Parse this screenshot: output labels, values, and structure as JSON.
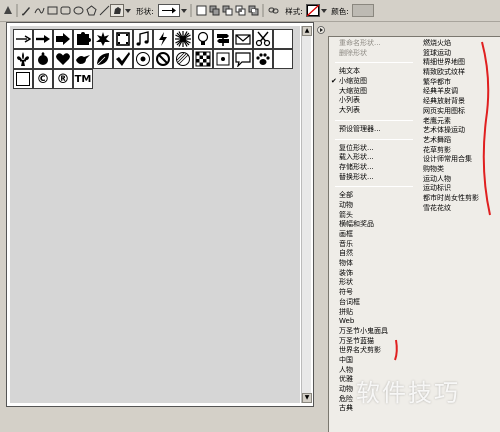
{
  "toolbar": {
    "shape_label": "形状:",
    "style_label": "样式:",
    "color_label": "颜色:"
  },
  "shapes": [
    {
      "icon": "arrow-right-thin-icon"
    },
    {
      "icon": "arrow-right-medium-icon"
    },
    {
      "icon": "arrow-right-bold-icon"
    },
    {
      "icon": "puzzle-piece-icon"
    },
    {
      "icon": "burst-star-icon"
    },
    {
      "icon": "film-frame-icon"
    },
    {
      "icon": "music-note-icon"
    },
    {
      "icon": "lightning-icon"
    },
    {
      "icon": "sun-burst-icon"
    },
    {
      "icon": "light-bulb-icon"
    },
    {
      "icon": "sign-post-icon"
    },
    {
      "icon": "envelope-icon"
    },
    {
      "icon": "scissors-icon"
    },
    {
      "icon": "blank-tile-icon"
    },
    {
      "icon": "fleur-de-lis-icon"
    },
    {
      "icon": "ornament-icon"
    },
    {
      "icon": "heart-icon"
    },
    {
      "icon": "bird-icon"
    },
    {
      "icon": "leaf-icon"
    },
    {
      "icon": "checkmark-icon"
    },
    {
      "icon": "target-icon"
    },
    {
      "icon": "no-sign-icon"
    },
    {
      "icon": "hatched-circle-icon"
    },
    {
      "icon": "checkerboard-icon"
    },
    {
      "icon": "square-dot-icon"
    },
    {
      "icon": "speech-bubble-icon"
    },
    {
      "icon": "paw-print-icon"
    },
    {
      "icon": "blank-tile-icon"
    },
    {
      "icon": "square-frame-icon"
    },
    {
      "icon": "copyright-icon",
      "text": "©"
    },
    {
      "icon": "registered-icon",
      "text": "®"
    },
    {
      "icon": "trademark-icon",
      "text": "TM"
    }
  ],
  "menu": {
    "col1": [
      {
        "label": "重命名形状...",
        "disabled": true
      },
      {
        "label": "删除形状",
        "disabled": true
      },
      {
        "sep": true
      },
      {
        "label": "纯文本"
      },
      {
        "label": "小缩览图",
        "checked": true
      },
      {
        "label": "大缩览图"
      },
      {
        "label": "小列表"
      },
      {
        "label": "大列表"
      },
      {
        "sep": true
      },
      {
        "label": "预设管理器..."
      },
      {
        "sep": true
      },
      {
        "label": "复位形状..."
      },
      {
        "label": "载入形状..."
      },
      {
        "label": "存储形状..."
      },
      {
        "label": "替换形状..."
      },
      {
        "sep": true
      },
      {
        "label": "全部"
      },
      {
        "label": "动物"
      },
      {
        "label": "箭头"
      },
      {
        "label": "横幅和奖品"
      },
      {
        "label": "画框"
      },
      {
        "label": "音乐"
      },
      {
        "label": "自然"
      },
      {
        "label": "物体"
      },
      {
        "label": "装饰"
      },
      {
        "label": "形状"
      },
      {
        "label": "符号"
      },
      {
        "label": "台词框"
      },
      {
        "label": "拼贴"
      },
      {
        "label": "Web"
      },
      {
        "label": "万圣节小鬼面具"
      },
      {
        "label": "万圣节蓝猫"
      },
      {
        "label": "世界名犬剪影"
      },
      {
        "label": "中国"
      },
      {
        "label": "人物"
      },
      {
        "label": "优雅"
      },
      {
        "label": "动物"
      },
      {
        "label": "危险"
      },
      {
        "label": "古典"
      }
    ],
    "col2": [
      {
        "label": "燃烧火焰"
      },
      {
        "label": "篮球运动"
      },
      {
        "label": "精细世界地图"
      },
      {
        "label": "精致欧式纹样"
      },
      {
        "label": "繁华都市"
      },
      {
        "label": "经典羊皮调"
      },
      {
        "label": "经典放射背景"
      },
      {
        "label": "网页实用图标"
      },
      {
        "label": "老鹰元素"
      },
      {
        "label": "艺术体操运动"
      },
      {
        "label": "艺术舞蹈"
      },
      {
        "label": "花草剪影"
      },
      {
        "label": "设计师常用合集"
      },
      {
        "label": "购物类"
      },
      {
        "label": "运动人物"
      },
      {
        "label": "运动标识"
      },
      {
        "label": "都市时尚女性剪影"
      },
      {
        "label": "雪花花纹"
      }
    ]
  },
  "watermark": "软件技巧",
  "colors": {
    "background": "#d4d0c8",
    "panel": "#d6d6d6",
    "menu": "#efede8",
    "annotation": "#e02020"
  }
}
